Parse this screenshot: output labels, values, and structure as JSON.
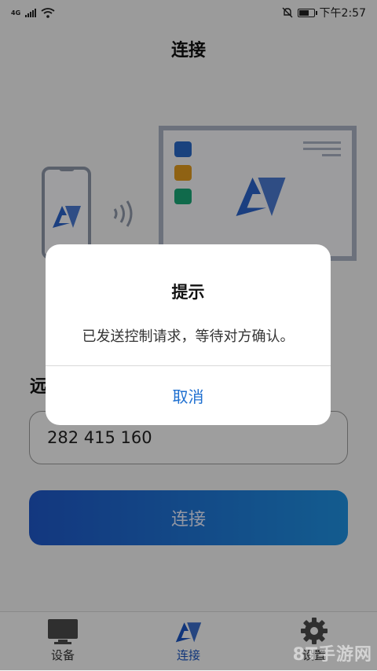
{
  "status_bar": {
    "network": "4G",
    "time": "下午2:57",
    "battery_level": 0.7
  },
  "page": {
    "title": "连接"
  },
  "illustration": {
    "brand_icon": "av-logo-icon",
    "square_colors": [
      "#2a68c6",
      "#e09a1f",
      "#1aa676"
    ]
  },
  "remote": {
    "label": "远",
    "id_value": "282 415 160"
  },
  "connect_button": {
    "label": "连接"
  },
  "tabs": [
    {
      "label": "设备",
      "icon": "monitor-icon"
    },
    {
      "label": "连接",
      "icon": "av-logo-icon"
    },
    {
      "label": "设置",
      "icon": "gear-icon"
    }
  ],
  "dialog": {
    "title": "提示",
    "message": "已发送控制请求，等待对方确认。",
    "cancel_label": "取消"
  },
  "watermark": "8T手游网",
  "colors": {
    "accent": "#1e6fd0",
    "brand_blue": "#1f57c7"
  }
}
